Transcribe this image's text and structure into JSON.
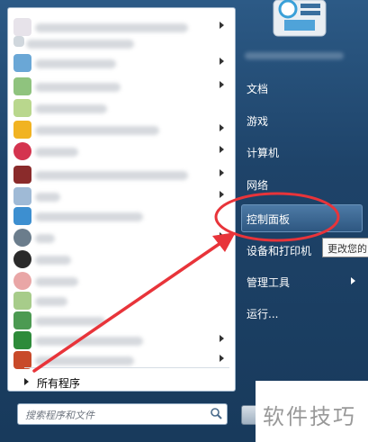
{
  "left_panel": {
    "all_programs_label": "所有程序",
    "search_placeholder": "搜索程序和文件"
  },
  "right_menu": {
    "items": [
      {
        "label": "文档"
      },
      {
        "label": "游戏"
      },
      {
        "label": "计算机"
      },
      {
        "label": "网络"
      },
      {
        "label": "控制面板"
      },
      {
        "label": "设备和打印机"
      },
      {
        "label": "管理工具"
      },
      {
        "label": "运行..."
      }
    ]
  },
  "tooltip": {
    "text": "更改您的"
  },
  "watermark": {
    "text": "软件技巧"
  },
  "colors": {
    "annotation_red": "#e8343a",
    "panel_blue": "#1e4369",
    "highlight_blue": "#3d6b97"
  }
}
